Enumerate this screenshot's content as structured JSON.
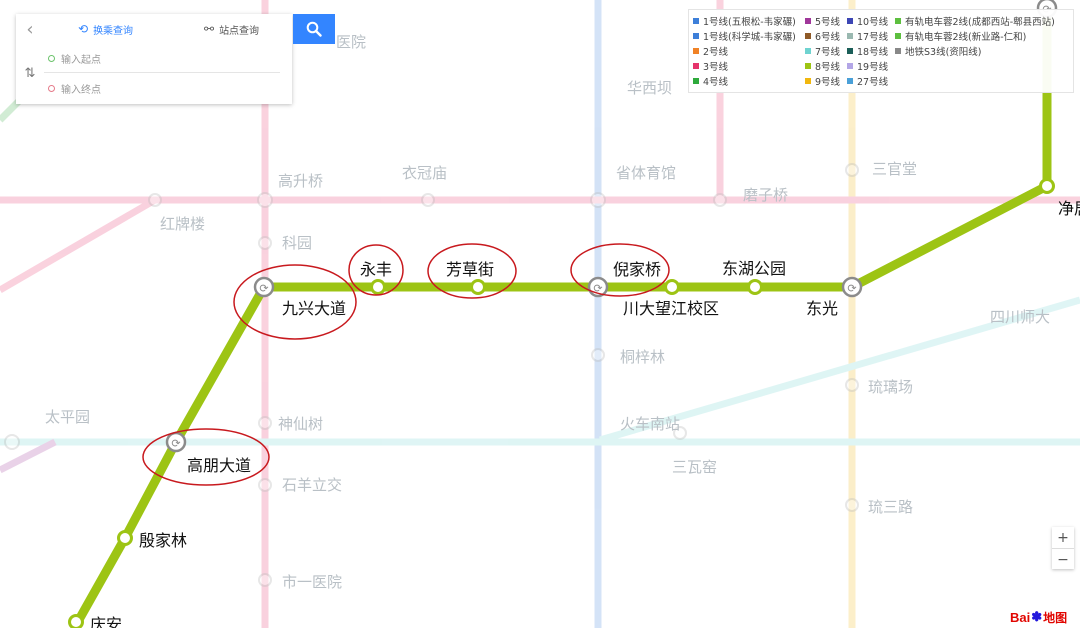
{
  "search": {
    "tab_transfer": "换乘查询",
    "tab_station": "站点查询",
    "start_placeholder": "输入起点",
    "end_placeholder": "输入终点"
  },
  "legend": {
    "col1": [
      {
        "label": "1号线(五根松-韦家碾)",
        "color": "#3d7fd9"
      },
      {
        "label": "1号线(科学城-韦家碾)",
        "color": "#3d7fd9"
      },
      {
        "label": "2号线",
        "color": "#f08226"
      },
      {
        "label": "3号线",
        "color": "#e6336b"
      },
      {
        "label": "4号线",
        "color": "#2eaa3c"
      }
    ],
    "col2": [
      {
        "label": "5号线",
        "color": "#a0379a"
      },
      {
        "label": "6号线",
        "color": "#8f5a28"
      },
      {
        "label": "7号线",
        "color": "#6fd3d0"
      },
      {
        "label": "8号线",
        "color": "#9dc414"
      },
      {
        "label": "9号线",
        "color": "#f1b70e"
      }
    ],
    "col3": [
      {
        "label": "10号线",
        "color": "#3c46b4"
      },
      {
        "label": "17号线",
        "color": "#9ab8b0"
      },
      {
        "label": "18号线",
        "color": "#1b5e58"
      },
      {
        "label": "19号线",
        "color": "#b3a6e6"
      },
      {
        "label": "27号线",
        "color": "#4aa0d8"
      }
    ],
    "col4": [
      {
        "label": "有轨电车蓉2线(成都西站-郫县西站)",
        "color": "#5dbf3f"
      },
      {
        "label": "有轨电车蓉2线(新业路-仁和)",
        "color": "#5dbf3f"
      },
      {
        "label": "地铁S3线(资阳线)",
        "color": "#888888"
      }
    ]
  },
  "faded_stations": [
    "华西坝",
    "省体育馆",
    "磨子桥",
    "衣冠庙",
    "高升桥",
    "红牌楼",
    "科园",
    "三官堂",
    "四川师大",
    "桐梓林",
    "火车南站",
    "三瓦窑",
    "琉璃场",
    "琉三路",
    "神仙树",
    "太平园",
    "石羊立交",
    "市一医院",
    "医院"
  ],
  "line8_stations": [
    "九兴大道",
    "永丰",
    "芳草街",
    "倪家桥",
    "川大望江校区",
    "东湖公园",
    "东光",
    "净居寺",
    "高朋大道",
    "殷家林",
    "庆安"
  ],
  "line8_labels": {
    "jiuxing": "九兴大道",
    "yongfeng": "永丰",
    "fangcao": "芳草街",
    "nijia": "倪家桥",
    "chuanda": "川大望江校区",
    "donghu": "东湖公园",
    "dongguang": "东光",
    "jingju": "净居",
    "gaopeng": "高朋大道",
    "yinjia": "殷家林",
    "qingan": "庆安"
  },
  "faded_labels": {
    "huaxiba": "华西坝",
    "shengti": "省体育馆",
    "mozi": "磨子桥",
    "yiguan": "衣冠庙",
    "gaosheng": "高升桥",
    "hongpai": "红牌楼",
    "keyuan": "科园",
    "sanguan": "三官堂",
    "sichuan": "四川师大",
    "tongzi": "桐梓林",
    "huoche": "火车南站",
    "sanwa": "三瓦窑",
    "liuli": "琉璃场",
    "liusan": "琉三路",
    "shenxian": "神仙树",
    "taiping": "太平园",
    "shiyang": "石羊立交",
    "shiyi": "市一医院",
    "yiyuan": "医院"
  },
  "zoom": {
    "in": "+",
    "out": "−"
  },
  "logo": {
    "bai": "Bai",
    "du": "du",
    "map": "地图"
  },
  "colors": {
    "line8": "#9dc414",
    "highlight_circle": "#c8191e",
    "search_button": "#3385ff"
  }
}
